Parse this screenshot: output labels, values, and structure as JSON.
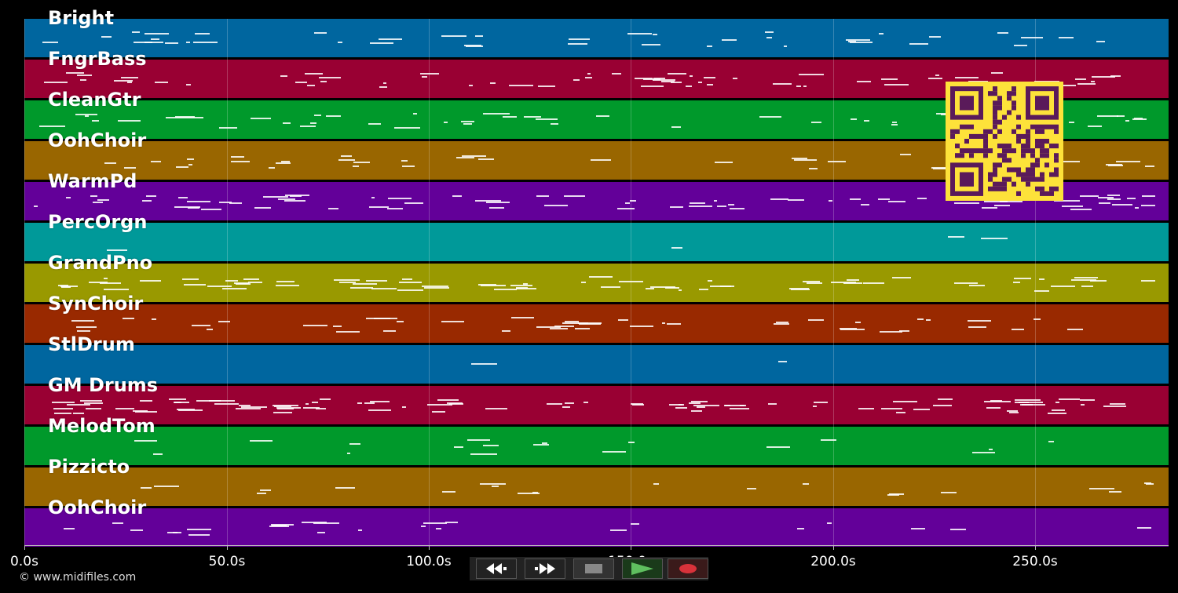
{
  "tracks": [
    {
      "name": "Bright",
      "color": "#00669f"
    },
    {
      "name": "FngrBass",
      "color": "#990033"
    },
    {
      "name": "CleanGtr",
      "color": "#00992b"
    },
    {
      "name": "OohChoir",
      "color": "#996600"
    },
    {
      "name": "WarmPd",
      "color": "#630099"
    },
    {
      "name": "PercOrgn",
      "color": "#009999"
    },
    {
      "name": "GrandPno",
      "color": "#999900"
    },
    {
      "name": "SynChoir",
      "color": "#992900"
    },
    {
      "name": "StlDrum",
      "color": "#00669f"
    },
    {
      "name": "GM Drums",
      "color": "#990033"
    },
    {
      "name": "MelodTom",
      "color": "#00992b"
    },
    {
      "name": "Pizzicto",
      "color": "#996600"
    },
    {
      "name": "OohChoir",
      "color": "#630099"
    }
  ],
  "timeline": {
    "ticks": [
      "0.0s",
      "50.0s",
      "100.0s",
      "150.0s",
      "200.0s",
      "250.0s"
    ],
    "grid_color": "#ffffff"
  },
  "transport": {
    "rewind_icon": "rewind-icon",
    "fast_forward_icon": "fast-forward-icon",
    "stop_icon": "stop-icon",
    "play_icon": "play-icon",
    "record_icon": "record-icon",
    "play_color": "#5fbf5f",
    "record_color": "#d8323a"
  },
  "footer": {
    "copyright": "© www.midifiles.com"
  },
  "qr": {
    "color": "#fde23a",
    "module_color": "#5a1a5a"
  }
}
